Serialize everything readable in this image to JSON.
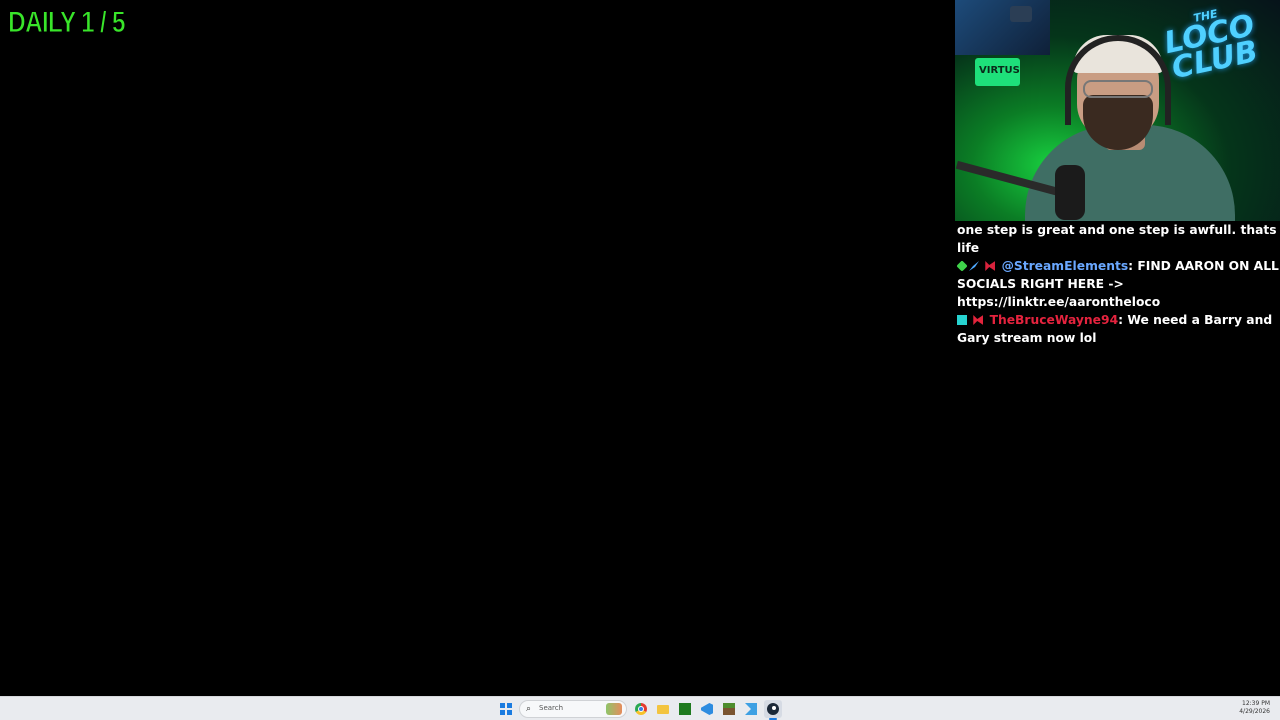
{
  "overlay": {
    "daily_counter": "DAILY 1 / 5"
  },
  "webcam": {
    "logo_line1": "THE",
    "logo_line2": "LOCO",
    "logo_line3": "CLUB",
    "shelf_label": "VIRTUS"
  },
  "chat": {
    "messages": [
      {
        "user": "",
        "text": "one step is great and one step is awfull. thats life",
        "badges": []
      },
      {
        "user": "@StreamElements",
        "separator": ":",
        "text": " FIND AARON ON ALL SOCIALS RIGHT HERE -> https://linktr.ee/aarontheloco",
        "user_color": "#6aa8ff",
        "badges": [
          "green-badge-icon",
          "pin-badge-icon",
          "bot-badge-icon"
        ]
      },
      {
        "user": "TheBruceWayne94",
        "separator": ":",
        "text": " We need a Barry and Gary stream now lol",
        "user_color": "#e5233e",
        "badges": [
          "subscriber-badge-icon",
          "bot-badge-icon"
        ]
      }
    ]
  },
  "taskbar": {
    "search_placeholder": "Search",
    "apps": [
      "start-icon",
      "search-icon",
      "chrome-icon",
      "file-explorer-icon",
      "nvidia-icon",
      "vscode-icon",
      "minecraft-icon",
      "tool-icon",
      "steam-icon"
    ],
    "clock_time": "12:39 PM",
    "clock_date": "4/29/2026",
    "accent_color": "#1a7be0"
  }
}
